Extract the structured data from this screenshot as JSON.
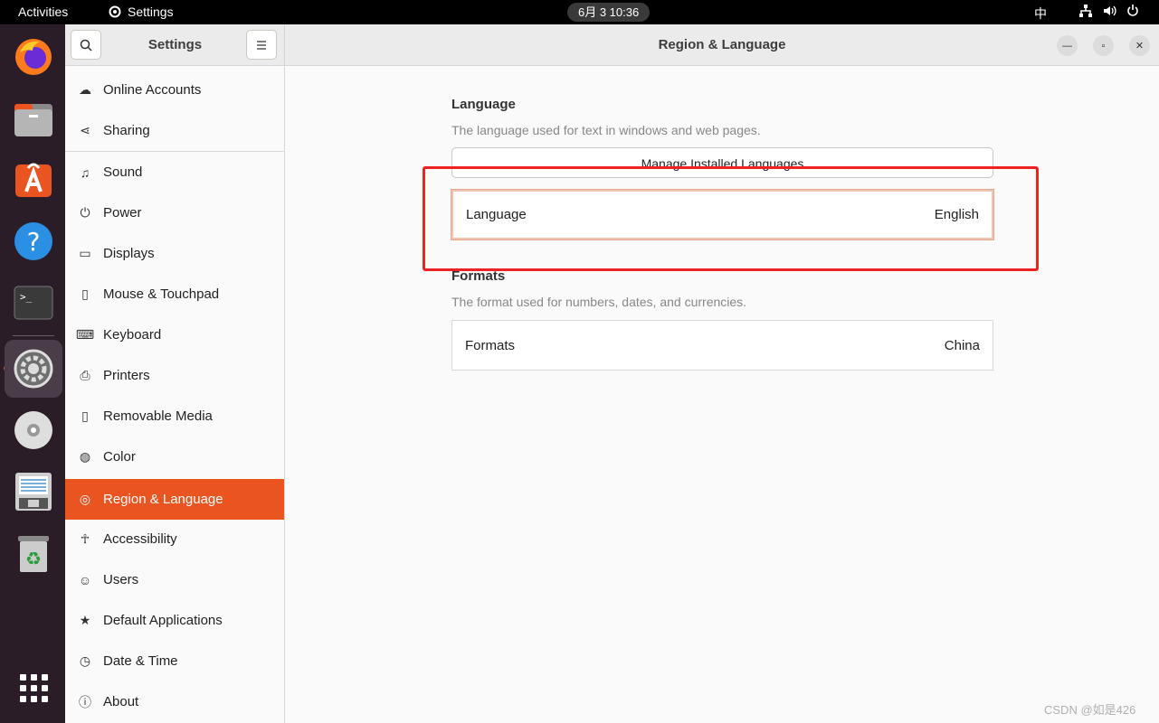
{
  "topbar": {
    "activities": "Activities",
    "app_name": "Settings",
    "clock": "6月 3  10:36",
    "ime": "中"
  },
  "dock": {
    "items": [
      "firefox-icon",
      "files-icon",
      "app-center-icon",
      "help-icon",
      "terminal-icon",
      "settings-icon",
      "disc-icon",
      "text-editor-icon",
      "trash-icon",
      "show-apps-icon"
    ]
  },
  "header": {
    "sidebar_title": "Settings",
    "page_title": "Region & Language"
  },
  "sidebar": {
    "items": [
      {
        "label": "Online Accounts",
        "icon": "☁"
      },
      {
        "label": "Sharing",
        "icon": "⋖"
      },
      {
        "label": "Sound",
        "icon": "♫"
      },
      {
        "label": "Power",
        "icon": "⏻"
      },
      {
        "label": "Displays",
        "icon": "▭"
      },
      {
        "label": "Mouse & Touchpad",
        "icon": "▯"
      },
      {
        "label": "Keyboard",
        "icon": "⌨"
      },
      {
        "label": "Printers",
        "icon": "⎙"
      },
      {
        "label": "Removable Media",
        "icon": "▯"
      },
      {
        "label": "Color",
        "icon": "◍"
      },
      {
        "label": "Region & Language",
        "icon": "◎"
      },
      {
        "label": "Accessibility",
        "icon": "☥"
      },
      {
        "label": "Users",
        "icon": "☺"
      },
      {
        "label": "Default Applications",
        "icon": "★"
      },
      {
        "label": "Date & Time",
        "icon": "◷"
      },
      {
        "label": "About",
        "icon": "ⓘ"
      }
    ]
  },
  "language_section": {
    "title": "Language",
    "description": "The language used for text in windows and web pages.",
    "manage_button": "Manage Installed Languages",
    "row_label": "Language",
    "row_value": "English"
  },
  "formats_section": {
    "title": "Formats",
    "description": "The format used for numbers, dates, and currencies.",
    "row_label": "Formats",
    "row_value": "China"
  },
  "watermark": "CSDN @如是426",
  "colors": {
    "accent": "#e95420",
    "annotation": "#ee2222",
    "dock": "#2b1d28"
  }
}
